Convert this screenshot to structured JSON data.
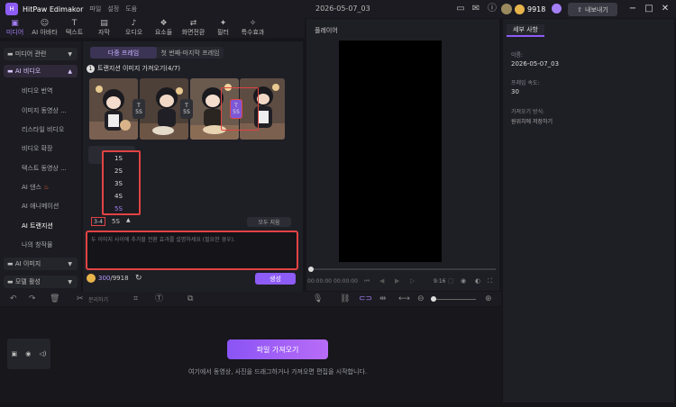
{
  "titlebar": {
    "logo": "H",
    "app_name": "HitPaw Edimakor",
    "menu": [
      "파일",
      "설정",
      "도움"
    ],
    "doc_title": "2026-05-07_03",
    "coins": "9918",
    "export_label": "내보내기"
  },
  "toptabs": [
    {
      "label": "미디어",
      "icon": "media-icon",
      "glyph": "▣"
    },
    {
      "label": "AI 아바타",
      "icon": "avatar-icon",
      "glyph": "☺"
    },
    {
      "label": "텍스트",
      "icon": "text-icon",
      "glyph": "T"
    },
    {
      "label": "자막",
      "icon": "subtitle-icon",
      "glyph": "▤"
    },
    {
      "label": "오디오",
      "icon": "audio-icon",
      "glyph": "♪"
    },
    {
      "label": "요소들",
      "icon": "elements-icon",
      "glyph": "❖"
    },
    {
      "label": "화면전환",
      "icon": "transition-icon",
      "glyph": "⇄"
    },
    {
      "label": "필터",
      "icon": "filter-icon",
      "glyph": "✦"
    },
    {
      "label": "특수효과",
      "icon": "effects-icon",
      "glyph": "✧"
    }
  ],
  "sidebar": {
    "folders": [
      {
        "label": "미디어 관련"
      },
      {
        "label": "AI 비디오"
      },
      {
        "label": "AI 이미지"
      },
      {
        "label": "모델 활성"
      }
    ],
    "items": [
      {
        "label": "비디오 번역"
      },
      {
        "label": "이미지 동영상 ..."
      },
      {
        "label": "리스타일 비디오"
      },
      {
        "label": "비디오 확장"
      },
      {
        "label": "텍스트 동영상 ..."
      },
      {
        "label": "AI 댄스"
      },
      {
        "label": "AI 애니메이션"
      },
      {
        "label": "AI 트랜지션"
      },
      {
        "label": "나의 창작물"
      }
    ]
  },
  "mid": {
    "seg_left": "다중 프레임",
    "seg_right": "첫 번째-마지막 프레임",
    "step_num": "1",
    "step_title": "트랜지션 이미지 가져오기(4/7)",
    "connectors": [
      "5S",
      "5S",
      "5S"
    ],
    "connector_icon": "T",
    "dropdown_options": [
      "1S",
      "2S",
      "3S",
      "4S",
      "5S"
    ],
    "selected_duration": "5S",
    "ratio": "3-4",
    "clear_label": "모두 지움",
    "prompt_placeholder": "두 이미지 사이에 추가할 전환 효과를 설명하세요 (필요한 경우).",
    "credits": "300",
    "credits_total": "/9918",
    "generate_label": "생성"
  },
  "preview": {
    "title": "플레이어",
    "time_current": "00:00:00",
    "time_total": "00:00:00",
    "ratio": "9:16"
  },
  "props": {
    "tab": "세부 사항",
    "name_label": "이름:",
    "name_value": "2026-05-07_03",
    "fps_label": "프레임 속도:",
    "fps_value": "30",
    "import_label": "가져오기 방식:",
    "import_value": "원위치에 저장하기"
  },
  "toolbar": {
    "split_label": "분리하기"
  },
  "timeline": {
    "import_button": "파일 가져오기",
    "hint": "여기에서 동영상, 사진을 드래그하거나 가져오면 편집을 시작합니다."
  },
  "colors": {
    "accent": "#8d5cf6",
    "highlight": "#e24343"
  }
}
